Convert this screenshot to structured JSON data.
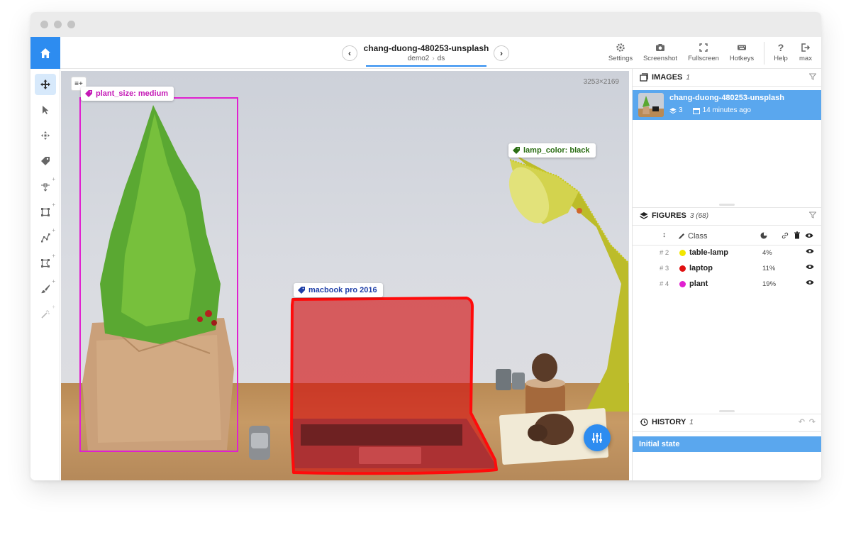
{
  "image": {
    "title": "chang-duong-480253-unsplash",
    "project": "demo2",
    "dataset": "ds",
    "dimensions": "3253×2169"
  },
  "toolbar": {
    "settings": "Settings",
    "screenshot": "Screenshot",
    "fullscreen": "Fullscreen",
    "hotkeys": "Hotkeys",
    "help": "Help",
    "user": "max"
  },
  "annotations": {
    "plant_tag": "plant_size: medium",
    "lamp_tag": "lamp_color: black",
    "laptop_tag": "macbook pro 2016"
  },
  "images_panel": {
    "title": "IMAGES",
    "count": "1",
    "item": {
      "name": "chang-duong-480253-unsplash",
      "layers": "3",
      "time": "14 minutes ago"
    }
  },
  "figures_panel": {
    "title": "FIGURES",
    "count": "3 (68)",
    "class_header": "Class",
    "rows": [
      {
        "num": "# 2",
        "name": "table-lamp",
        "pct": "4%",
        "color": "#f2e600"
      },
      {
        "num": "# 3",
        "name": "laptop",
        "pct": "11%",
        "color": "#e01010"
      },
      {
        "num": "# 4",
        "name": "plant",
        "pct": "19%",
        "color": "#e020d0"
      }
    ]
  },
  "history_panel": {
    "title": "HISTORY",
    "count": "1",
    "entry": "Initial state"
  },
  "colors": {
    "accent": "#2d8cf0",
    "selection": "#5aa7ee",
    "plant": "#e020d0",
    "laptop": "#e01010",
    "lamp": "#c8c81e"
  }
}
